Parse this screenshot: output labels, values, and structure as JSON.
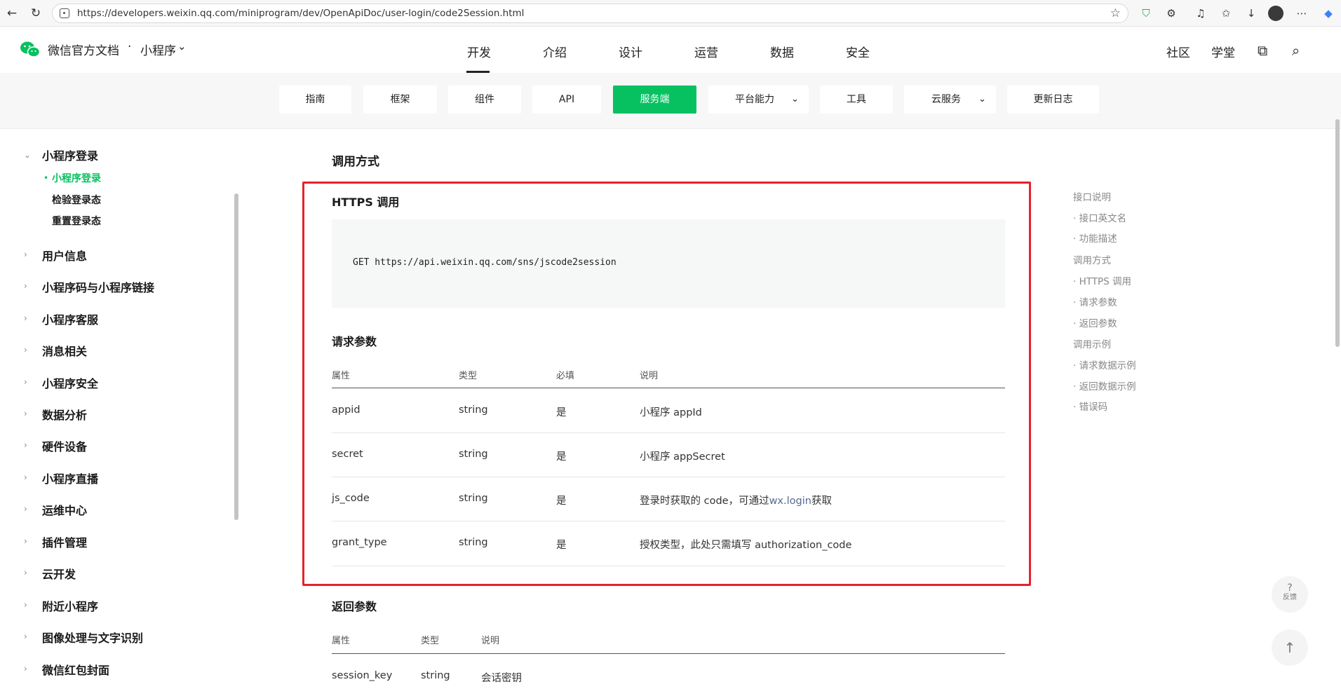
{
  "browser": {
    "url": "https://developers.weixin.qq.com/miniprogram/dev/OpenApiDoc/user-login/code2Session.html"
  },
  "header": {
    "brand": "微信官方文档",
    "separator": "·",
    "section": "小程序",
    "nav": [
      "开发",
      "介绍",
      "设计",
      "运营",
      "数据",
      "安全"
    ],
    "active_nav": "开发",
    "community": "社区",
    "academy": "学堂"
  },
  "subnav": {
    "tabs": [
      "指南",
      "框架",
      "组件",
      "API",
      "服务端",
      "平台能力",
      "工具",
      "云服务",
      "更新日志"
    ],
    "active": "服务端"
  },
  "sidebar": {
    "group": "小程序登录",
    "sub_items": [
      "小程序登录",
      "检验登录态",
      "重置登录态"
    ],
    "items": [
      "用户信息",
      "小程序码与小程序链接",
      "小程序客服",
      "消息相关",
      "小程序安全",
      "数据分析",
      "硬件设备",
      "小程序直播",
      "运维中心",
      "插件管理",
      "云开发",
      "附近小程序",
      "图像处理与文字识别",
      "微信红包封面"
    ]
  },
  "content": {
    "section_title": "调用方式",
    "https_title": "HTTPS 调用",
    "code": "GET https://api.weixin.qq.com/sns/jscode2session",
    "request_title": "请求参数",
    "request_headers": [
      "属性",
      "类型",
      "必填",
      "说明"
    ],
    "request_rows": [
      [
        "appid",
        "string",
        "是",
        "小程序 appId"
      ],
      [
        "secret",
        "string",
        "是",
        "小程序 appSecret"
      ],
      [
        "js_code",
        "string",
        "是",
        "登录时获取的 code，可通过",
        "wx.login",
        "获取"
      ],
      [
        "grant_type",
        "string",
        "是",
        "授权类型，此处只需填写 authorization_code"
      ]
    ],
    "response_title": "返回参数",
    "response_headers": [
      "属性",
      "类型",
      "说明"
    ],
    "response_rows": [
      [
        "session_key",
        "string",
        "会话密钥"
      ]
    ]
  },
  "toc": {
    "items": [
      "接口说明",
      "· 接口英文名",
      "· 功能描述",
      "调用方式",
      "· HTTPS 调用",
      "· 请求参数",
      "· 返回参数",
      "调用示例",
      "· 请求数据示例",
      "· 返回数据示例",
      "· 错误码"
    ]
  },
  "float": {
    "feedback_icon": "?",
    "feedback_label": "反馈",
    "top_icon": "↑"
  },
  "colors": {
    "accent": "#07c160",
    "highlight_box": "#e8202a",
    "link": "#576b95"
  }
}
